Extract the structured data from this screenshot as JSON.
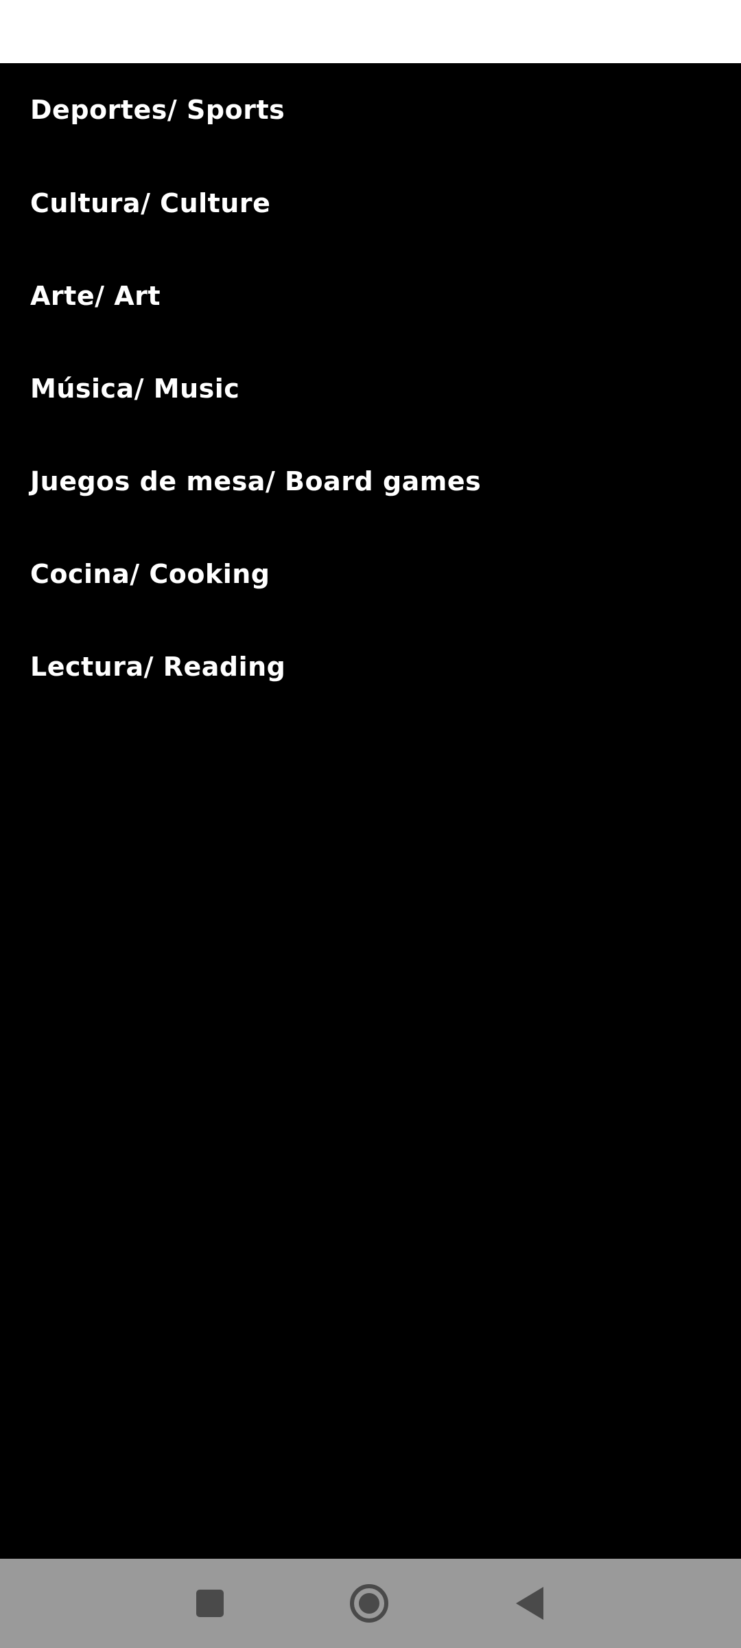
{
  "menu": {
    "items": [
      {
        "label": "Deportes/ Sports"
      },
      {
        "label": "Cultura/ Culture"
      },
      {
        "label": "Arte/ Art"
      },
      {
        "label": "Música/ Music"
      },
      {
        "label": "Juegos de mesa/ Board games"
      },
      {
        "label": "Cocina/ Cooking"
      },
      {
        "label": "Lectura/ Reading"
      }
    ]
  },
  "nav_bar": {
    "buttons": [
      {
        "icon": "recents-square-icon"
      },
      {
        "icon": "home-circle-icon"
      },
      {
        "icon": "back-triangle-icon"
      }
    ]
  },
  "colors": {
    "background": "#000000",
    "text": "#ffffff",
    "status_bar": "#ffffff",
    "nav_bar": "#9a9a9a",
    "nav_icon": "#4a4a4a"
  }
}
